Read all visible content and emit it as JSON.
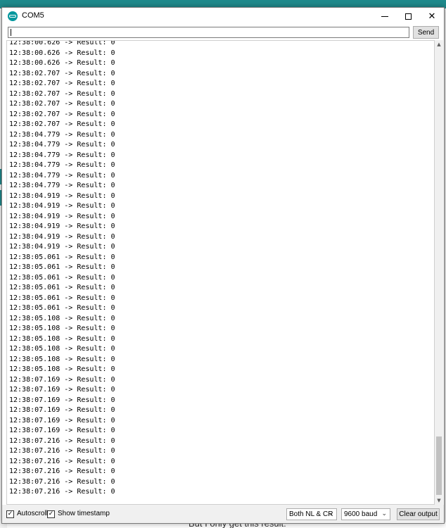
{
  "window": {
    "title": "COM5",
    "icon": "arduino-icon",
    "minimize_icon": "minimize-icon",
    "maximize_icon": "maximize-icon",
    "close_symbol": "✕"
  },
  "input_bar": {
    "value": "",
    "send_label": "Send"
  },
  "output": {
    "lines": [
      "12:38:00.626 -> Result: 0",
      "12:38:00.626 -> Result: 0",
      "12:38:00.626 -> Result: 0",
      "12:38:02.707 -> Result: 0",
      "12:38:02.707 -> Result: 0",
      "12:38:02.707 -> Result: 0",
      "12:38:02.707 -> Result: 0",
      "12:38:02.707 -> Result: 0",
      "12:38:02.707 -> Result: 0",
      "12:38:04.779 -> Result: 0",
      "12:38:04.779 -> Result: 0",
      "12:38:04.779 -> Result: 0",
      "12:38:04.779 -> Result: 0",
      "12:38:04.779 -> Result: 0",
      "12:38:04.779 -> Result: 0",
      "12:38:04.919 -> Result: 0",
      "12:38:04.919 -> Result: 0",
      "12:38:04.919 -> Result: 0",
      "12:38:04.919 -> Result: 0",
      "12:38:04.919 -> Result: 0",
      "12:38:04.919 -> Result: 0",
      "12:38:05.061 -> Result: 0",
      "12:38:05.061 -> Result: 0",
      "12:38:05.061 -> Result: 0",
      "12:38:05.061 -> Result: 0",
      "12:38:05.061 -> Result: 0",
      "12:38:05.061 -> Result: 0",
      "12:38:05.108 -> Result: 0",
      "12:38:05.108 -> Result: 0",
      "12:38:05.108 -> Result: 0",
      "12:38:05.108 -> Result: 0",
      "12:38:05.108 -> Result: 0",
      "12:38:05.108 -> Result: 0",
      "12:38:07.169 -> Result: 0",
      "12:38:07.169 -> Result: 0",
      "12:38:07.169 -> Result: 0",
      "12:38:07.169 -> Result: 0",
      "12:38:07.169 -> Result: 0",
      "12:38:07.169 -> Result: 0",
      "12:38:07.216 -> Result: 0",
      "12:38:07.216 -> Result: 0",
      "12:38:07.216 -> Result: 0",
      "12:38:07.216 -> Result: 0",
      "12:38:07.216 -> Result: 0",
      "12:38:07.216 -> Result: 0"
    ],
    "scroll_position": 1.0
  },
  "bottom_bar": {
    "autoscroll_label": "Autoscroll",
    "autoscroll_checked": true,
    "timestamp_label": "Show timestamp",
    "timestamp_checked": true,
    "line_ending": "Both NL & CR",
    "baud_rate": "9600 baud",
    "clear_label": "Clear output"
  },
  "background": {
    "bottom_text": "But I only get this result:",
    "accent_color": "#1f8a8c"
  },
  "colors": {
    "window_bg": "#ffffff",
    "button_bg": "#e1e1e1",
    "arduino_teal": "#00979d"
  }
}
